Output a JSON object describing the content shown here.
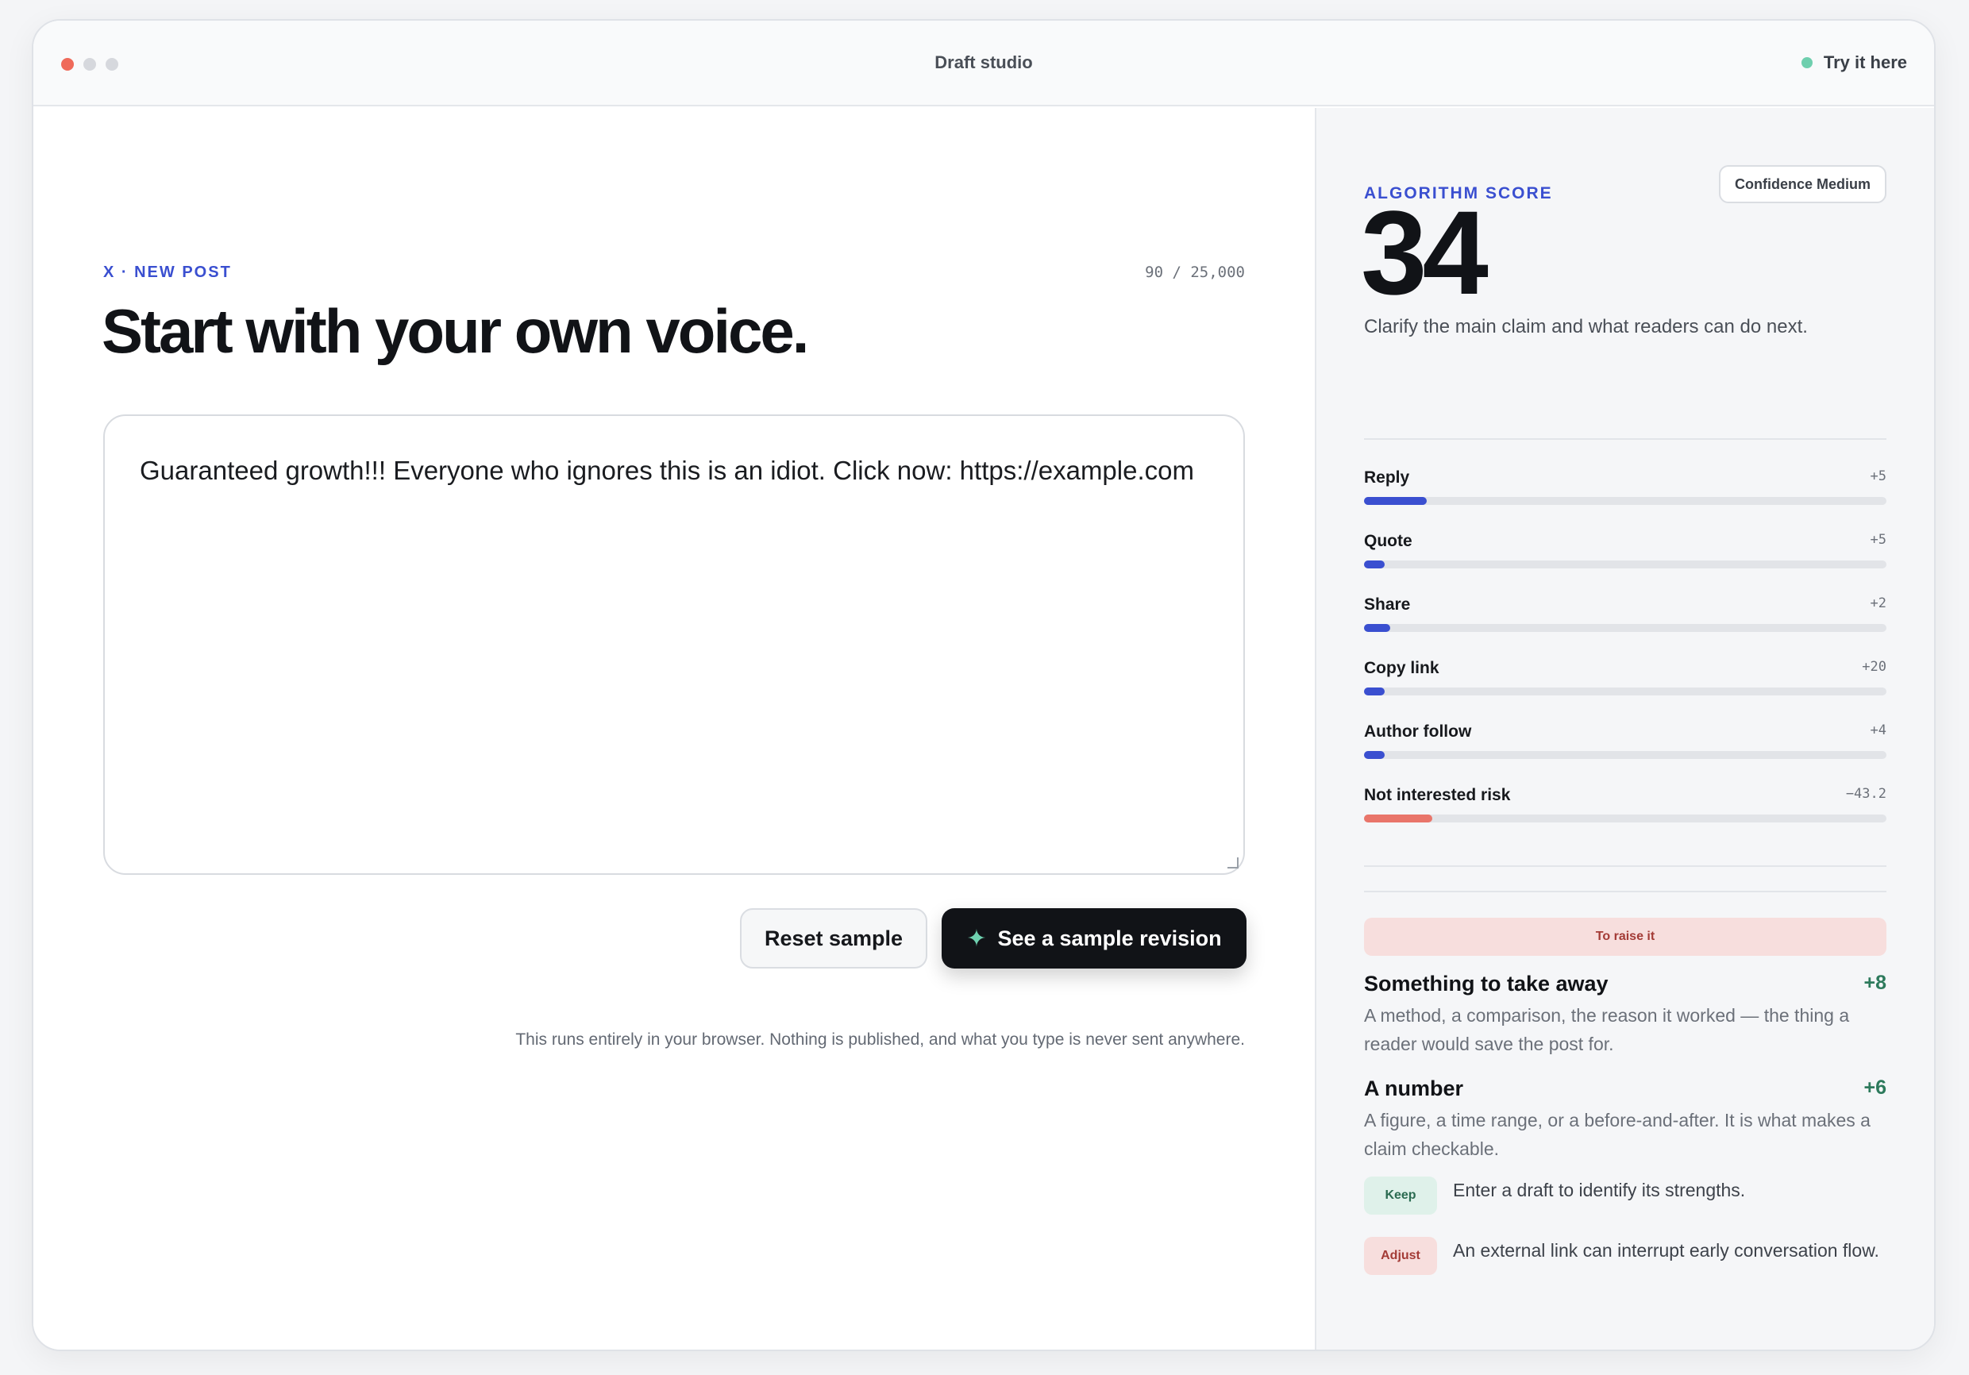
{
  "window": {
    "title": "Draft studio",
    "try_label": "Try it here"
  },
  "editor": {
    "kicker": "X · NEW POST",
    "counter": "90 / 25,000",
    "headline": "Start with your own voice.",
    "draft_text": "Guaranteed growth!!! Everyone who ignores this is an idiot. Click now: https://example.com",
    "reset_label": "Reset sample",
    "revise_label": "See a sample revision",
    "privacy_note": "This runs entirely in your browser. Nothing is published, and what you type is never sent anywhere."
  },
  "score_panel": {
    "kicker": "ALGORITHM SCORE",
    "score": "34",
    "confidence": "Confidence Medium",
    "note": "Clarify the main claim and what readers can do next.",
    "metrics": [
      {
        "label": "Reply",
        "delta": "+5",
        "level": 0.12,
        "color": "#3a4fd0"
      },
      {
        "label": "Quote",
        "delta": "+5",
        "level": 0.04,
        "color": "#3a4fd0"
      },
      {
        "label": "Share",
        "delta": "+2",
        "level": 0.05,
        "color": "#3a4fd0"
      },
      {
        "label": "Copy link",
        "delta": "+20",
        "level": 0.04,
        "color": "#3a4fd0"
      },
      {
        "label": "Author follow",
        "delta": "+4",
        "level": 0.04,
        "color": "#3a4fd0"
      },
      {
        "label": "Not interested risk",
        "delta": "−43.2",
        "level": 0.13,
        "color": "#e9756a"
      }
    ],
    "raise_label": "To raise it",
    "tips": [
      {
        "title": "Something to take away",
        "gain": "+8",
        "body": "A method, a comparison, the reason it worked — the thing a reader would save the post for."
      },
      {
        "title": "A number",
        "gain": "+6",
        "body": "A figure, a time range, or a before-and-after. It is what makes a claim checkable."
      }
    ],
    "notes": [
      {
        "badge": "Keep",
        "text": "Enter a draft to identify its strengths."
      },
      {
        "badge": "Adjust",
        "text": "An external link can interrupt early conversation flow."
      }
    ]
  }
}
